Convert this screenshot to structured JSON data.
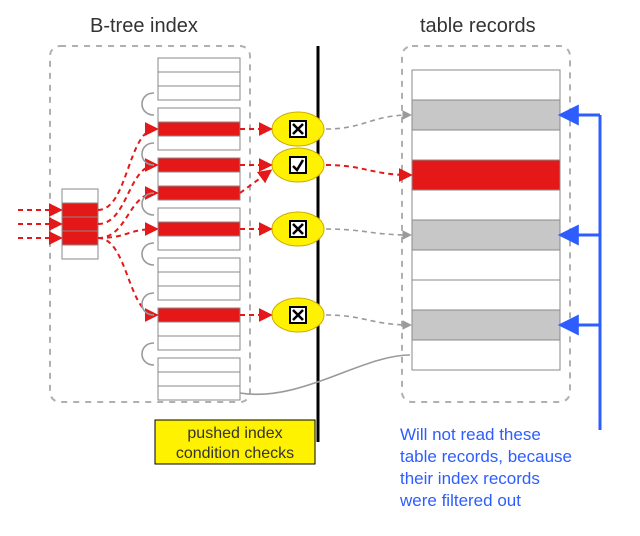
{
  "titles": {
    "btree": "B-tree index",
    "tableRecords": "table records"
  },
  "rootNode": {
    "rows": 5,
    "highlighted": [
      1,
      2,
      3
    ]
  },
  "leafBlocks": [
    {
      "rows": 3,
      "highlighted": []
    },
    {
      "rows": 3,
      "highlighted": [
        1
      ]
    },
    {
      "rows": 3,
      "highlighted": [
        0,
        2
      ]
    },
    {
      "rows": 3,
      "highlighted": [
        1
      ]
    },
    {
      "rows": 3,
      "highlighted": []
    },
    {
      "rows": 3,
      "highlighted": [
        0
      ]
    },
    {
      "rows": 3,
      "highlighted": []
    }
  ],
  "checks": [
    {
      "pass": false
    },
    {
      "pass": true
    },
    {
      "pass": false
    },
    {
      "pass": false
    }
  ],
  "tableRows": [
    {
      "state": "empty"
    },
    {
      "state": "skip"
    },
    {
      "state": "empty"
    },
    {
      "state": "read"
    },
    {
      "state": "empty"
    },
    {
      "state": "skip"
    },
    {
      "state": "empty"
    },
    {
      "state": "empty"
    },
    {
      "state": "skip"
    },
    {
      "state": "empty"
    }
  ],
  "pushedLabel": {
    "l1": "pushed index",
    "l2": "condition checks"
  },
  "annotation": {
    "l1": "Will not read these",
    "l2": "table records, because",
    "l3": "their index records",
    "l4": "were filtered out"
  }
}
